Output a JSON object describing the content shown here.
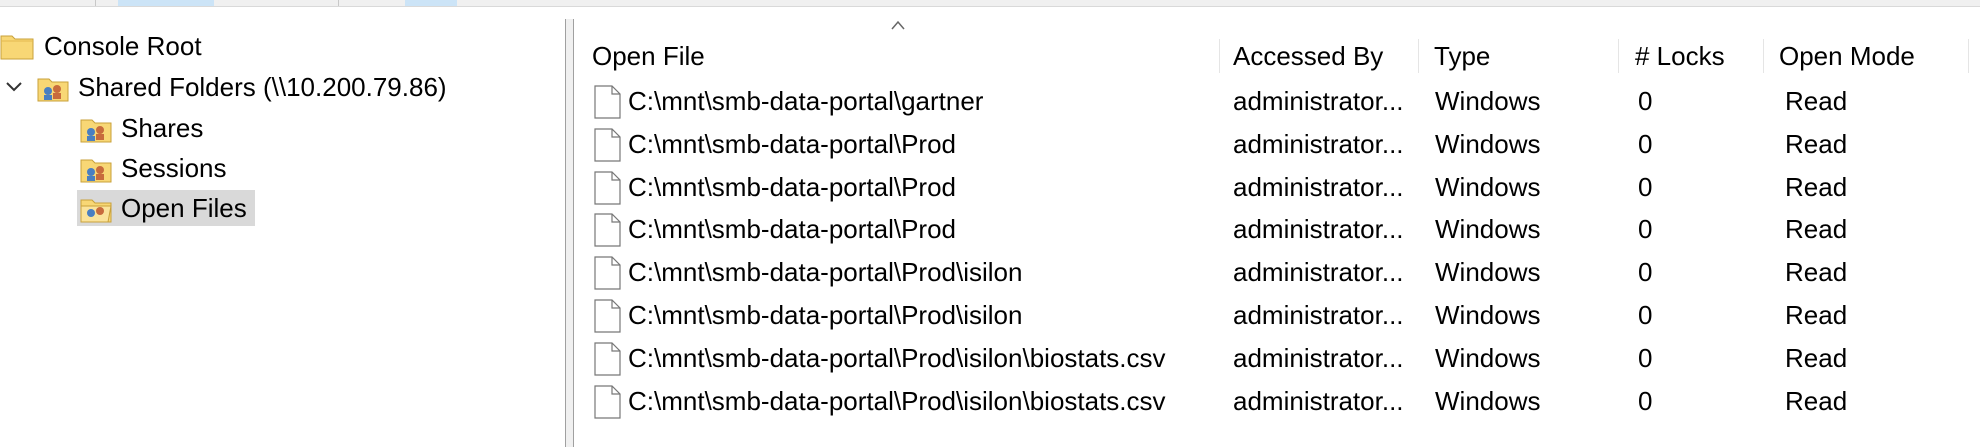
{
  "tree": {
    "root_label": "Console Root",
    "shared_folders_label": "Shared Folders (\\\\10.200.79.86)",
    "children": [
      {
        "label": "Shares"
      },
      {
        "label": "Sessions"
      },
      {
        "label": "Open Files",
        "selected": true
      }
    ]
  },
  "list": {
    "columns": [
      "Open File",
      "Accessed By",
      "Type",
      "# Locks",
      "Open Mode"
    ],
    "sort_column": "Open File",
    "rows": [
      {
        "file": "C:\\mnt\\smb-data-portal\\gartner",
        "accessed_by": "administrator...",
        "type": "Windows",
        "locks": "0",
        "mode": "Read"
      },
      {
        "file": "C:\\mnt\\smb-data-portal\\Prod",
        "accessed_by": "administrator...",
        "type": "Windows",
        "locks": "0",
        "mode": "Read"
      },
      {
        "file": "C:\\mnt\\smb-data-portal\\Prod",
        "accessed_by": "administrator...",
        "type": "Windows",
        "locks": "0",
        "mode": "Read"
      },
      {
        "file": "C:\\mnt\\smb-data-portal\\Prod",
        "accessed_by": "administrator...",
        "type": "Windows",
        "locks": "0",
        "mode": "Read"
      },
      {
        "file": "C:\\mnt\\smb-data-portal\\Prod\\isilon",
        "accessed_by": "administrator...",
        "type": "Windows",
        "locks": "0",
        "mode": "Read"
      },
      {
        "file": "C:\\mnt\\smb-data-portal\\Prod\\isilon",
        "accessed_by": "administrator...",
        "type": "Windows",
        "locks": "0",
        "mode": "Read"
      },
      {
        "file": "C:\\mnt\\smb-data-portal\\Prod\\isilon\\biostats.csv",
        "accessed_by": "administrator...",
        "type": "Windows",
        "locks": "0",
        "mode": "Read"
      },
      {
        "file": "C:\\mnt\\smb-data-portal\\Prod\\isilon\\biostats.csv",
        "accessed_by": "administrator...",
        "type": "Windows",
        "locks": "0",
        "mode": "Read"
      }
    ]
  },
  "colors": {
    "selection": "#d9d9d9",
    "folder": "#f8d775",
    "toolbar_highlight": "#cce4f7"
  }
}
